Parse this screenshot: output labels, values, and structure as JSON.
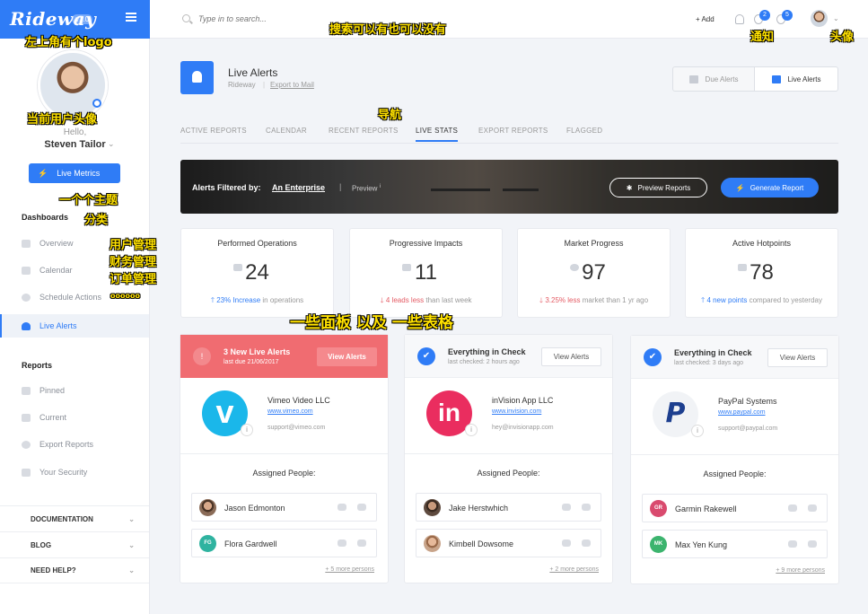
{
  "app": {
    "logo": "Rideway",
    "version": "v1.0"
  },
  "user": {
    "hello": "Hello,",
    "name": "Steven Tailor"
  },
  "sidebar": {
    "main_button": "Live Metrics",
    "section1": "Dashboards",
    "items1": [
      {
        "label": "Overview"
      },
      {
        "label": "Calendar"
      },
      {
        "label": "Schedule Actions"
      },
      {
        "label": "Live Alerts"
      }
    ],
    "section2": "Reports",
    "items2": [
      {
        "label": "Pinned"
      },
      {
        "label": "Current"
      },
      {
        "label": "Export Reports"
      },
      {
        "label": "Your Security"
      }
    ],
    "footer": [
      {
        "label": "DOCUMENTATION"
      },
      {
        "label": "BLOG"
      },
      {
        "label": "NEED HELP?"
      }
    ]
  },
  "topbar": {
    "search_placeholder": "Type in to search...",
    "add": "+ Add",
    "notif1": "2",
    "notif2": "5"
  },
  "header": {
    "title": "Live Alerts",
    "sub": "Rideway",
    "sub_link": "Export to Mail",
    "due_btn": "Due Alerts",
    "live_btn": "Live Alerts"
  },
  "tabs": [
    "ACTIVE REPORTS",
    "CALENDAR",
    "RECENT REPORTS",
    "LIVE STATS",
    "EXPORT REPORTS",
    "FLAGGED"
  ],
  "banner": {
    "label": "Alerts Filtered by:",
    "link": "An Enterprise",
    "sep": "|",
    "preview": "Preview",
    "preview_btn": "Preview Reports",
    "generate_btn": "Generate Report"
  },
  "stats": [
    {
      "title": "Performed Operations",
      "value": "24",
      "change": "23% Increase",
      "rest": "in operations",
      "dir": "up"
    },
    {
      "title": "Progressive Impacts",
      "value": "11",
      "change": "4 leads less",
      "rest": "than last week",
      "dir": "down"
    },
    {
      "title": "Market Progress",
      "value": "97",
      "change": "3.25% less",
      "rest": "market than 1 yr ago",
      "dir": "down"
    },
    {
      "title": "Active Hotpoints",
      "value": "78",
      "change": "4 new points",
      "rest": "compared to yesterday",
      "dir": "up"
    }
  ],
  "cards": [
    {
      "head_icon": "!",
      "title": "3 New Live Alerts",
      "sub": "last due 21/06/2017",
      "btn": "View Alerts",
      "company": "Vimeo Video LLC",
      "url": "www.vimeo.com",
      "mail": "support@vimeo.com",
      "assigned": "Assigned People:",
      "people": [
        {
          "name": "Jason Edmonton",
          "initials": ""
        },
        {
          "name": "Flora Gardwell",
          "initials": "FG"
        }
      ],
      "more": "+ 5 more persons"
    },
    {
      "head_icon": "✔",
      "title": "Everything in Check",
      "sub": "last checked: 2 hours ago",
      "btn": "View Alerts",
      "company": "inVision App LLC",
      "url": "www.invision.com",
      "mail": "hey@invisionapp.com",
      "assigned": "Assigned People:",
      "people": [
        {
          "name": "Jake Herstwhich",
          "initials": ""
        },
        {
          "name": "Kimbell Dowsome",
          "initials": ""
        }
      ],
      "more": "+ 2 more persons"
    },
    {
      "head_icon": "✔",
      "title": "Everything in Check",
      "sub": "last checked: 3 days ago",
      "btn": "View Alerts",
      "company": "PayPal Systems",
      "url": "www.paypal.com",
      "mail": "support@paypal.com",
      "assigned": "Assigned People:",
      "people": [
        {
          "name": "Garmin Rakewell",
          "initials": "GR"
        },
        {
          "name": "Max Yen Kung",
          "initials": "MK"
        }
      ],
      "more": "+ 9 more persons"
    }
  ],
  "logos": {
    "vimeo": "v",
    "invision": "in",
    "paypal": "P"
  },
  "annotations": {
    "logo": "左上角有个logo",
    "avatar": "当前用户头像",
    "theme": "一个个主题",
    "category": "分类",
    "user_mgmt": "用户管理",
    "finance": "财务管理",
    "orders": "订单管理",
    "dots": "oooooo",
    "search": "搜索可以有也可以没有",
    "nav": "导航",
    "notify": "通知",
    "head": "头像",
    "panels": "一些面板 以及 一些表格"
  },
  "colors": {
    "accent": "#2f7cf6",
    "alert": "#f06c71",
    "down": "#e45b64"
  }
}
